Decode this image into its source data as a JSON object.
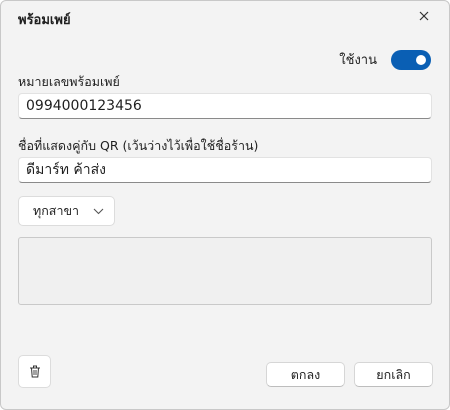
{
  "dialog": {
    "title": "พร้อมเพย์",
    "close_icon": "close-icon"
  },
  "toggle": {
    "label": "ใช้งาน",
    "on": true,
    "accent": "#0a5fb4"
  },
  "phone_field": {
    "label": "หมายเลขพร้อมเพย์",
    "value": "0994000123456"
  },
  "name_field": {
    "label": "ชื่อที่แสดงคู่กับ QR (เว้นว่างไว้เพื่อใช้ชื่อร้าน)",
    "value": "ดีมาร์ท ค้าส่ง"
  },
  "branch_dropdown": {
    "selected": "ทุกสาขา",
    "icon": "chevron-down-icon"
  },
  "actions": {
    "delete_icon": "trash-icon",
    "ok_label": "ตกลง",
    "cancel_label": "ยกเลิก"
  }
}
